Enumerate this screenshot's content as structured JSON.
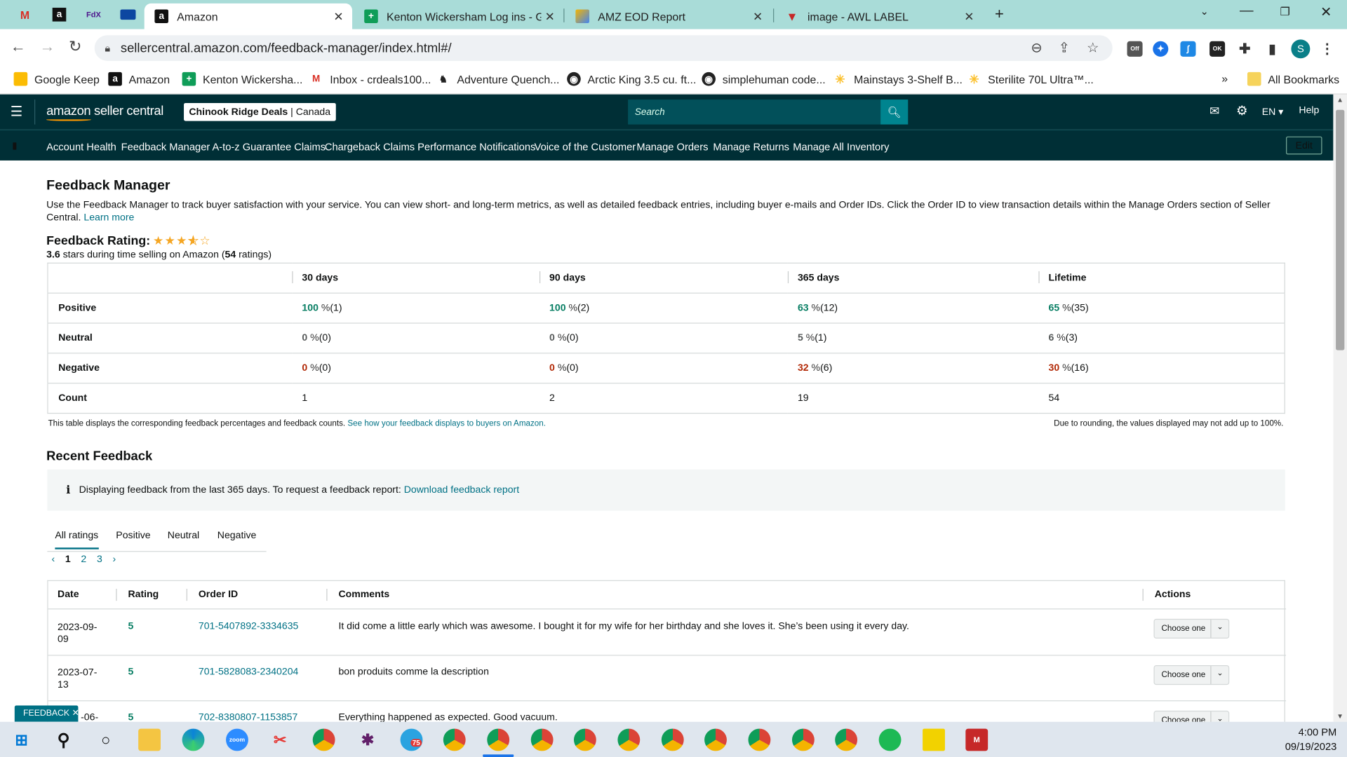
{
  "browser": {
    "tabs": [
      {
        "title": "Amazon"
      },
      {
        "title": "Kenton Wickersham Log ins - Go"
      },
      {
        "title": "AMZ EOD Report"
      },
      {
        "title": "image - AWL LABEL"
      }
    ],
    "url": "sellercentral.amazon.com/feedback-manager/index.html#/",
    "profile_initial": "S",
    "bookmarks": [
      "Google Keep",
      "Amazon",
      "Kenton Wickersha...",
      "Inbox - crdeals100...",
      "Adventure Quench...",
      "Arctic King 3.5 cu. ft...",
      "simplehuman code...",
      "Mainstays 3-Shelf B...",
      "Sterilite 70L Ultra™..."
    ],
    "all_bookmarks": "All Bookmarks",
    "ext_badges": {
      "off": "Off",
      "ok": "OK"
    }
  },
  "header": {
    "logo": "amazon seller central",
    "store": "Chinook Ridge Deals",
    "marketplace": "Canada",
    "search_placeholder": "Search",
    "lang": "EN",
    "help": "Help",
    "edit": "Edit",
    "nav": [
      "Account Health",
      "Feedback Manager",
      "A-to-z Guarantee Claims",
      "Chargeback Claims",
      "Performance Notifications",
      "Voice of the Customer",
      "Manage Orders",
      "Manage Returns",
      "Manage All Inventory"
    ]
  },
  "page": {
    "title": "Feedback Manager",
    "intro": "Use the Feedback Manager to track buyer satisfaction with your service. You can view short- and long-term metrics, as well as detailed feedback entries, including buyer e-mails and Order IDs. Click the Order ID to view transaction details within the Manage Orders section of Seller Central.",
    "learn_more": "Learn more",
    "rating_label": "Feedback Rating:",
    "rating_value": 3.6,
    "stars_text": "3.6",
    "stars_suffix_a": "stars during time selling on Amazon (",
    "ratings_count": "54",
    "stars_suffix_b": "ratings)"
  },
  "summary": {
    "columns": [
      "30 days",
      "90 days",
      "365 days",
      "Lifetime"
    ],
    "rows": [
      {
        "label": "Positive",
        "cells": [
          {
            "v": "100",
            "c": "(1)"
          },
          {
            "v": "100",
            "c": "(2)"
          },
          {
            "v": "63",
            "c": "(12)"
          },
          {
            "v": "65",
            "c": "(35)"
          }
        ]
      },
      {
        "label": "Neutral",
        "cells": [
          {
            "v": "0",
            "c": "(0)"
          },
          {
            "v": "0",
            "c": "(0)"
          },
          {
            "v": "5",
            "c": "(1)"
          },
          {
            "v": "6",
            "c": "(3)"
          }
        ]
      },
      {
        "label": "Negative",
        "cells": [
          {
            "v": "0",
            "c": "(0)"
          },
          {
            "v": "0",
            "c": "(0)"
          },
          {
            "v": "32",
            "c": "(6)"
          },
          {
            "v": "30",
            "c": "(16)"
          }
        ]
      },
      {
        "label": "Count",
        "cells": [
          {
            "v": "1"
          },
          {
            "v": "2"
          },
          {
            "v": "19"
          },
          {
            "v": "54"
          }
        ]
      }
    ],
    "pct_unit": "%",
    "note": "This table displays the corresponding feedback percentages and feedback counts.",
    "note_link": "See how your feedback displays to buyers on Amazon.",
    "rounding_note": "Due to rounding, the values displayed may not add up to 100%."
  },
  "recent": {
    "title": "Recent Feedback",
    "info": "Displaying feedback from the last 365 days. To request a feedback report:",
    "info_link": "Download feedback report",
    "filters": [
      "All ratings",
      "Positive",
      "Neutral",
      "Negative"
    ],
    "pages": [
      "1",
      "2",
      "3"
    ],
    "columns": [
      "Date",
      "Rating",
      "Order ID",
      "Comments",
      "Actions"
    ],
    "rows": [
      {
        "date": "2023-09-09",
        "rating": "5",
        "order_id": "701-5407892-3334635",
        "comment": "It did come a little early which was awesome. I bought it for my wife for her birthday and she loves it. She’s been using it every day."
      },
      {
        "date": "2023-07-13",
        "rating": "5",
        "order_id": "701-5828083-2340204",
        "comment": "bon produits comme la description"
      },
      {
        "date": "-06-",
        "rating": "5",
        "order_id": "702-8380807-1153857",
        "comment": "Everything happened as expected. Good vacuum."
      }
    ],
    "action_label": "Choose one",
    "feedback_badge": "FEEDBACK"
  },
  "taskbar": {
    "time": "4:00 PM",
    "date": "09/19/2023",
    "badge": "75",
    "zoom_label": "zoom"
  },
  "colors": {
    "header_bg": "#002f36",
    "accent": "#007185",
    "positive": "#067d62",
    "negative": "#b12704",
    "tab_bg": "#a9dcd8"
  }
}
